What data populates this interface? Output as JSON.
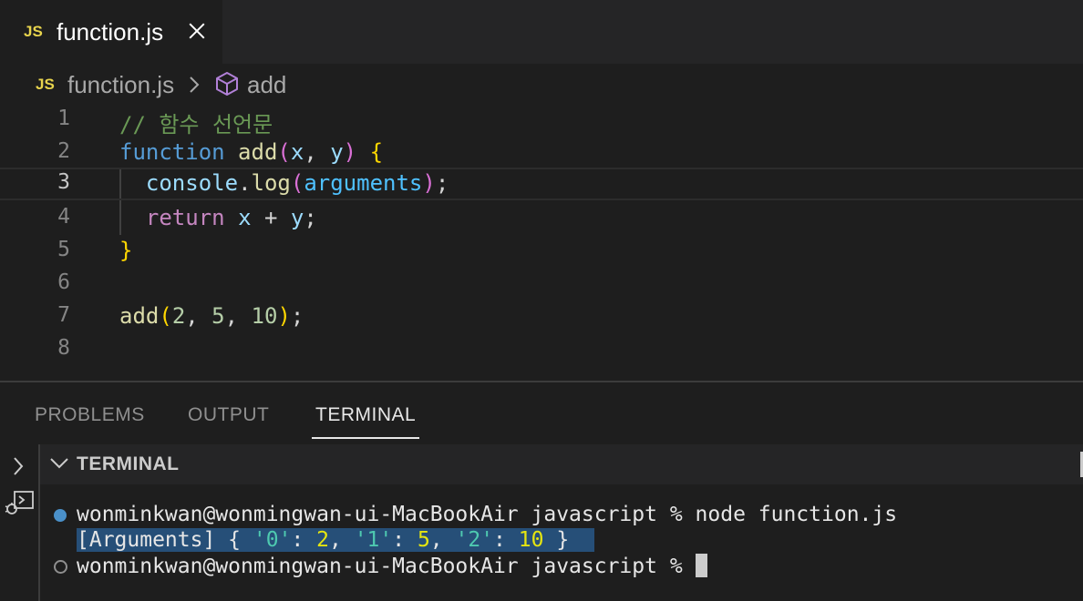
{
  "tab": {
    "icon": "JS",
    "filename": "function.js"
  },
  "breadcrumb": {
    "icon": "JS",
    "file": "function.js",
    "symbol": "add"
  },
  "editor": {
    "lines": [
      {
        "num": "1",
        "comment": "// 함수 선언문"
      },
      {
        "num": "2",
        "kw": "function",
        "fn": "add",
        "p1": "x",
        "p2": "y"
      },
      {
        "num": "3",
        "obj": "console",
        "method": "log",
        "arg": "arguments"
      },
      {
        "num": "4",
        "kw": "return",
        "a": "x",
        "op": "+",
        "b": "y"
      },
      {
        "num": "5",
        "brace": "}"
      },
      {
        "num": "6"
      },
      {
        "num": "7",
        "fn": "add",
        "n1": "2",
        "n2": "5",
        "n3": "10"
      },
      {
        "num": "8"
      }
    ]
  },
  "panel": {
    "tabs": [
      "PROBLEMS",
      "OUTPUT",
      "TERMINAL"
    ],
    "active_tab": "TERMINAL",
    "terminal_title": "TERMINAL"
  },
  "terminal": {
    "prompt": "wonminkwan@wonmingwan-ui-MacBookAir javascript %",
    "command": "node function.js",
    "output": {
      "prefix": "[Arguments] {",
      "k0": "'0'",
      "v0": "2",
      "k1": "'1'",
      "v1": "5",
      "k2": "'2'",
      "v2": "10",
      "suffix": "}"
    }
  },
  "colors": {
    "js_icon": "#e8d44d",
    "cube_icon": "#b180d7",
    "selection": "#264f78",
    "status_dot": "#4a90c9"
  }
}
